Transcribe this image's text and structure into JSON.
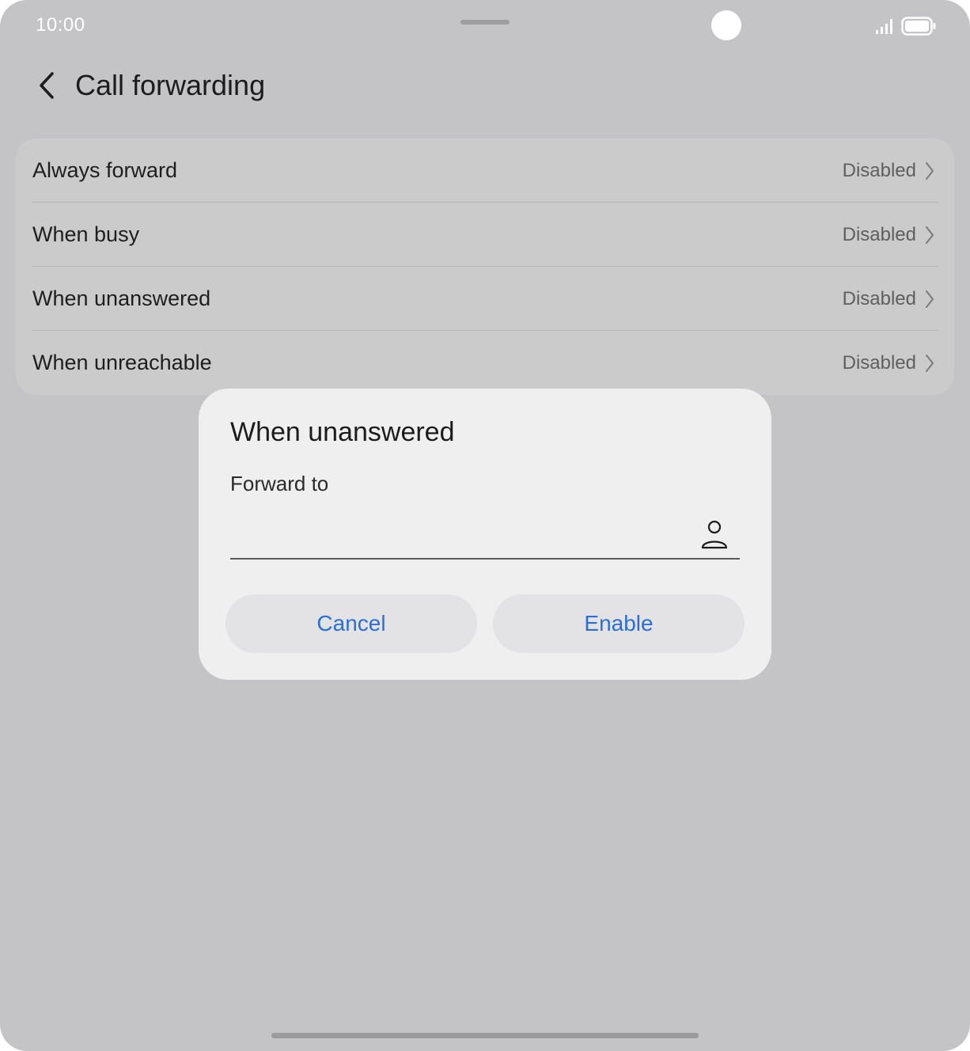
{
  "status_bar": {
    "time": "10:00",
    "signal_icon": "signal-icon",
    "battery_icon": "battery-icon"
  },
  "header": {
    "back_icon": "back-arrow-icon",
    "title": "Call forwarding"
  },
  "forwarding_options": [
    {
      "label": "Always forward",
      "value": "Disabled"
    },
    {
      "label": "When busy",
      "value": "Disabled"
    },
    {
      "label": "When unanswered",
      "value": "Disabled"
    },
    {
      "label": "When unreachable",
      "value": "Disabled"
    }
  ],
  "dialog": {
    "title": "When unanswered",
    "field_label": "Forward to",
    "field_value": "",
    "contact_icon": "contact-person-icon",
    "cancel_label": "Cancel",
    "enable_label": "Enable"
  },
  "colors": {
    "accent": "#2b6fd6",
    "scrim_background": "#c4c4c6",
    "dialog_background": "#efeff0"
  }
}
